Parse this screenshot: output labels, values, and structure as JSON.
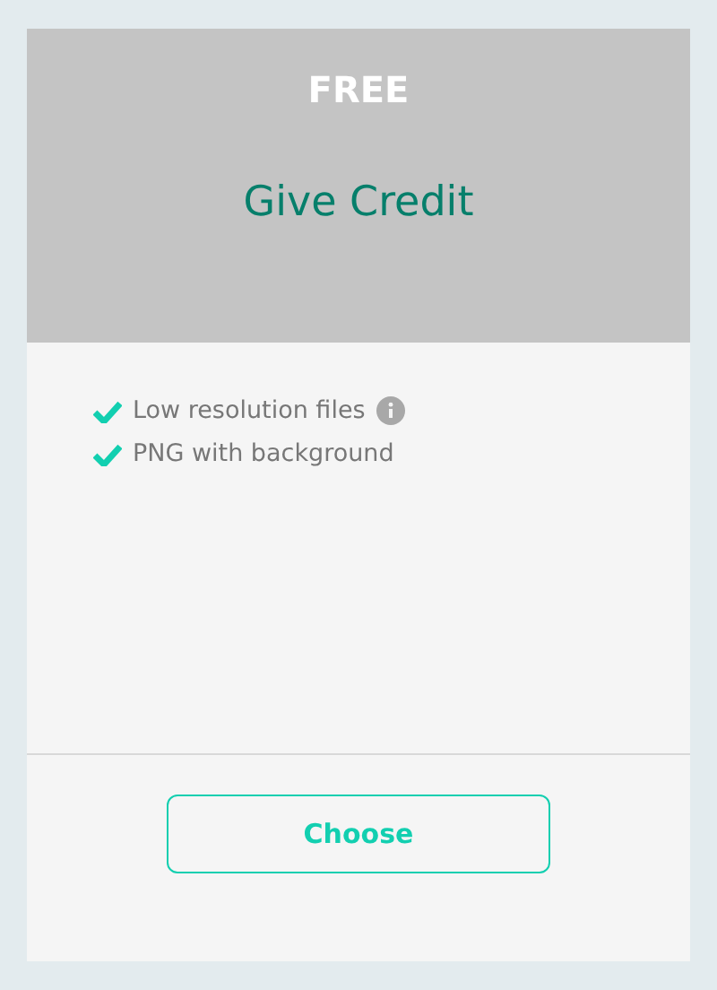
{
  "plan": {
    "tier": "FREE",
    "name": "Give Credit"
  },
  "features": [
    {
      "text": "Low resolution files",
      "info": true
    },
    {
      "text": "PNG with background",
      "info": false
    }
  ],
  "action": {
    "label": "Choose"
  }
}
